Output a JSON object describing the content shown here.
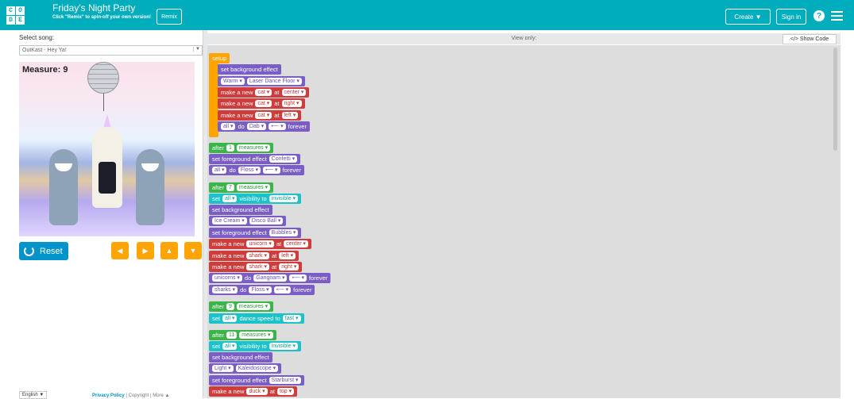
{
  "header": {
    "logo_letters": [
      "C",
      "O",
      "D",
      "E"
    ],
    "title": "Friday's Night Party",
    "subtitle": "Click \"Remix\" to spin-off your own version!",
    "remix_label": "Remix",
    "create_label": "Create ▼",
    "signin_label": "Sign in",
    "help_icon": "?"
  },
  "left": {
    "select_label": "Select song:",
    "song_value": "OutKast - Hey Ya!",
    "measure_text": "Measure: 9",
    "reset_label": "Reset",
    "arrows": [
      "◀",
      "▶",
      "▲",
      "▼"
    ],
    "language": "English ▼",
    "footer": {
      "privacy": "Privacy Policy",
      "sep1": " | ",
      "copyright": "Copyright",
      "sep2": " | ",
      "more": "More ▲"
    }
  },
  "code": {
    "view_only": "View only:",
    "show_code": "</> Show Code"
  },
  "blocks": [
    {
      "id": "b0",
      "parts": [
        "setup"
      ]
    },
    {
      "id": "b1",
      "parts": [
        "set background effect"
      ]
    },
    {
      "id": "b2",
      "parts": [
        {
          "f": "Warm ▾"
        },
        {
          "f": "Laser Dance Floor ▾"
        }
      ]
    },
    {
      "id": "b3",
      "parts": [
        "make a new",
        {
          "f": "cat ▾"
        },
        "at",
        {
          "f": "center ▾"
        }
      ]
    },
    {
      "id": "b4",
      "parts": [
        "make a new",
        {
          "f": "cat ▾"
        },
        "at",
        {
          "f": "right ▾"
        }
      ]
    },
    {
      "id": "b5",
      "parts": [
        "make a new",
        {
          "f": "cat ▾"
        },
        "at",
        {
          "f": "left ▾"
        }
      ]
    },
    {
      "id": "b6",
      "parts": [
        {
          "f": "all ▾"
        },
        "do",
        {
          "f": "Dab ▾"
        },
        {
          "f": "⟵ ▾"
        },
        "forever"
      ]
    },
    {
      "id": "b7",
      "parts": [
        "after",
        {
          "f": "1"
        },
        {
          "f": "measures ▾"
        }
      ]
    },
    {
      "id": "b8",
      "parts": [
        "set foreground effect",
        {
          "f": "Confetti ▾"
        }
      ]
    },
    {
      "id": "b9",
      "parts": [
        {
          "f": "all ▾"
        },
        "do",
        {
          "f": "Floss ▾"
        },
        {
          "f": "⟵ ▾"
        },
        "forever"
      ]
    },
    {
      "id": "b10",
      "parts": [
        "after",
        {
          "f": "7"
        },
        {
          "f": "measures ▾"
        }
      ]
    },
    {
      "id": "b11",
      "parts": [
        "set",
        {
          "f": "all ▾"
        },
        "visibility to",
        {
          "f": "invisible ▾"
        }
      ]
    },
    {
      "id": "b12",
      "parts": [
        "set background effect"
      ]
    },
    {
      "id": "b13",
      "parts": [
        {
          "f": "Ice Cream ▾"
        },
        {
          "f": "Disco Ball ▾"
        }
      ]
    },
    {
      "id": "b14",
      "parts": [
        "set foreground effect",
        {
          "f": "Bubbles ▾"
        }
      ]
    },
    {
      "id": "b15",
      "parts": [
        "make a new",
        {
          "f": "unicorn ▾"
        },
        "at",
        {
          "f": "center ▾"
        }
      ]
    },
    {
      "id": "b16",
      "parts": [
        "make a new",
        {
          "f": "shark ▾"
        },
        "at",
        {
          "f": "left ▾"
        }
      ]
    },
    {
      "id": "b17",
      "parts": [
        "make a new",
        {
          "f": "shark ▾"
        },
        "at",
        {
          "f": "right ▾"
        }
      ]
    },
    {
      "id": "b18",
      "parts": [
        {
          "f": "unicorns ▾"
        },
        "do",
        {
          "f": "Gangnam ▾"
        },
        {
          "f": "⟵ ▾"
        },
        "forever"
      ]
    },
    {
      "id": "b19",
      "parts": [
        {
          "f": "sharks ▾"
        },
        "do",
        {
          "f": "Floss ▾"
        },
        {
          "f": "⟵ ▾"
        },
        "forever"
      ]
    },
    {
      "id": "b20",
      "parts": [
        "after",
        {
          "f": "9"
        },
        {
          "f": "measures ▾"
        }
      ]
    },
    {
      "id": "b21",
      "parts": [
        "set",
        {
          "f": "all ▾"
        },
        "dance speed to",
        {
          "f": "fast ▾"
        }
      ]
    },
    {
      "id": "b22",
      "parts": [
        "after",
        {
          "f": "11"
        },
        {
          "f": "measures ▾"
        }
      ]
    },
    {
      "id": "b23",
      "parts": [
        "set",
        {
          "f": "all ▾"
        },
        "visibility to",
        {
          "f": "invisible ▾"
        }
      ]
    },
    {
      "id": "b24",
      "parts": [
        "set background effect"
      ]
    },
    {
      "id": "b25",
      "parts": [
        {
          "f": "Light ▾"
        },
        {
          "f": "Kaleidoscope ▾"
        }
      ]
    },
    {
      "id": "b26",
      "parts": [
        "set foreground effect",
        {
          "f": "Starburst ▾"
        }
      ]
    },
    {
      "id": "b27",
      "parts": [
        "make a new",
        {
          "f": "duck ▾"
        },
        "at",
        {
          "f": "top ▾"
        }
      ]
    }
  ],
  "colors": {
    "header": "#00adbc",
    "orange": "#ffa400",
    "purple": "#7a5ec6",
    "red": "#cf3c3c",
    "green": "#3bb54a",
    "teal": "#1cc2c9",
    "reset": "#0094ca"
  }
}
